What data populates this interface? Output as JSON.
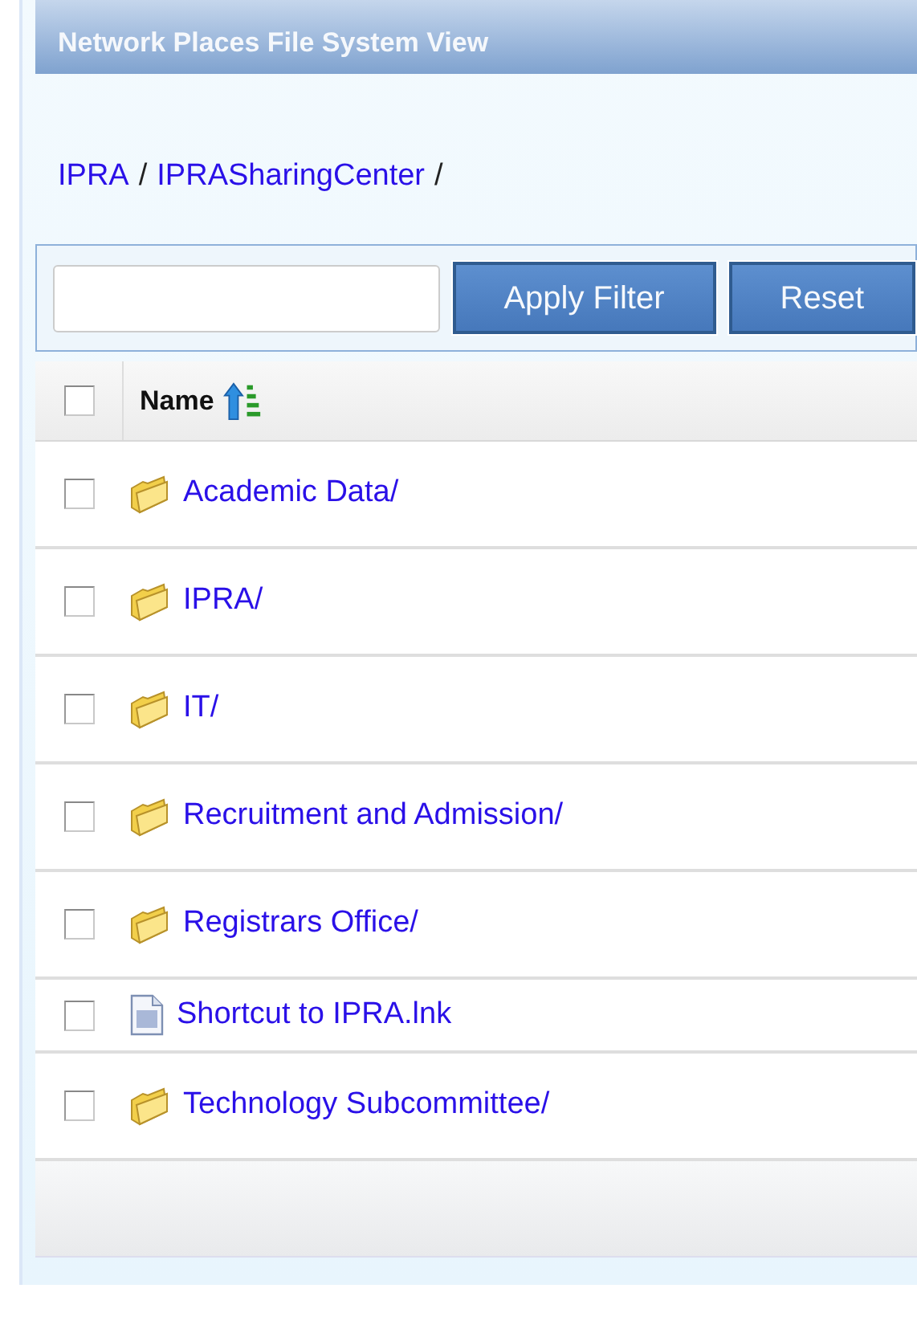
{
  "window": {
    "title": "Network Places File System View"
  },
  "breadcrumb": [
    {
      "kind": "link",
      "text": "IPRA"
    },
    {
      "kind": "separator",
      "text": "/"
    },
    {
      "kind": "link",
      "text": "IPRASharingCenter"
    },
    {
      "kind": "separator",
      "text": "/"
    }
  ],
  "filter": {
    "buttons": [
      "Apply Filter",
      "Reset"
    ]
  },
  "table": {
    "header": {
      "checked": false,
      "column": "Name"
    },
    "rows": [
      {
        "kind": "folder",
        "name": "Academic Data/",
        "checked": false
      },
      {
        "kind": "folder",
        "name": "IPRA/",
        "checked": false
      },
      {
        "kind": "folder",
        "name": "IT/",
        "checked": false
      },
      {
        "kind": "folder",
        "name": "Recruitment and Admission/",
        "checked": false
      },
      {
        "kind": "folder",
        "name": "Registrars Office/",
        "checked": false
      },
      {
        "kind": "file",
        "name": "Shortcut to IPRA.lnk",
        "checked": false
      },
      {
        "kind": "folder",
        "name": "Technology Subcommittee/",
        "checked": false
      }
    ]
  }
}
